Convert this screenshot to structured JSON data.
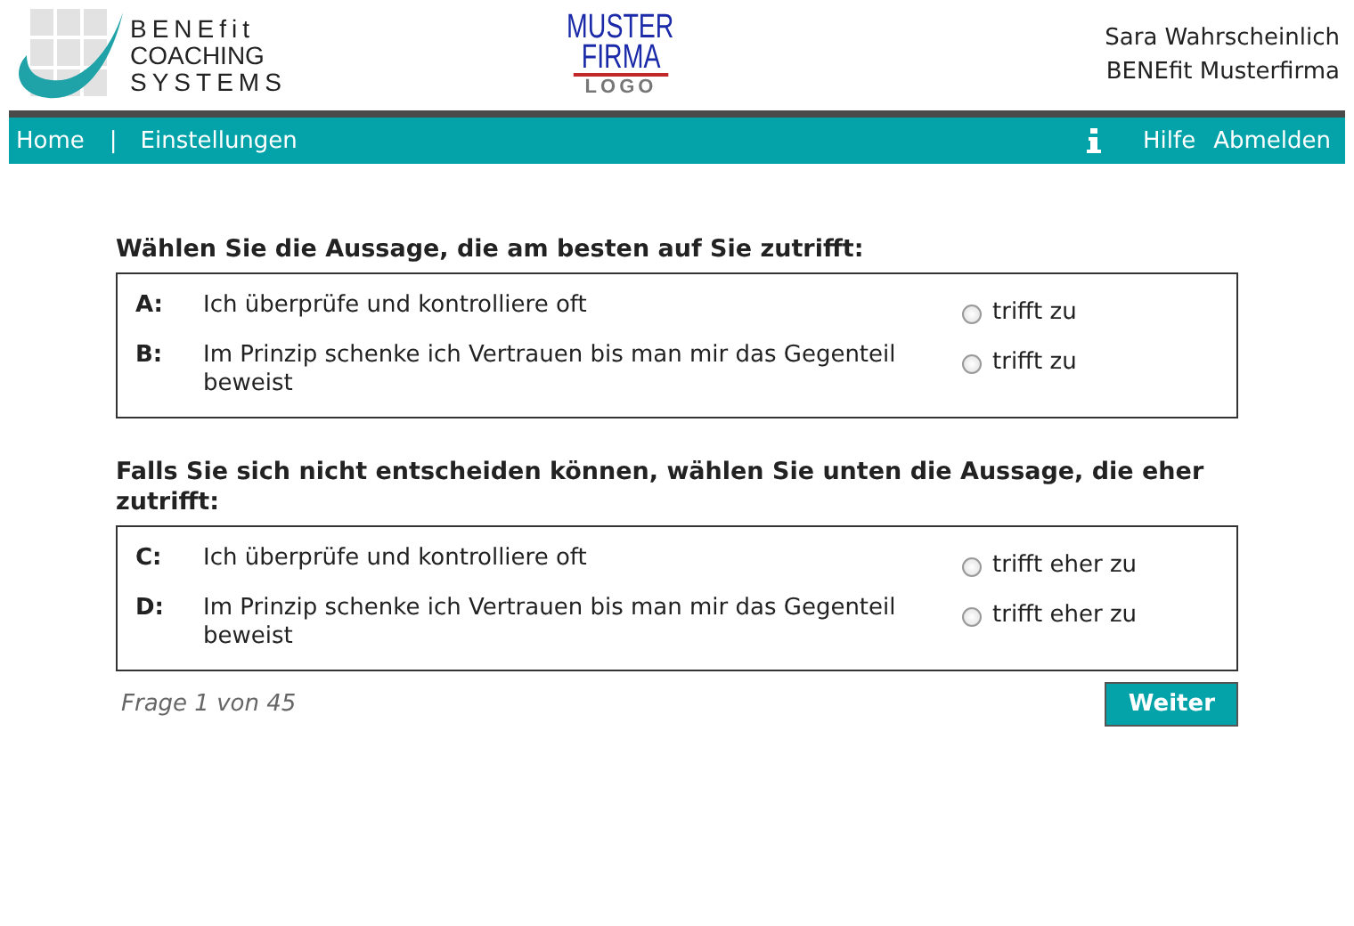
{
  "logo": {
    "lines": [
      "BENEfit",
      "COACHING",
      "SYSTEMS"
    ]
  },
  "company_logo": {
    "lines": [
      "MUSTER",
      "FIRMA",
      "LOGO"
    ]
  },
  "user": {
    "name": "Sara Wahrscheinlich",
    "company": "BENEfit Musterfirma"
  },
  "nav": {
    "left": [
      {
        "label": "Home"
      },
      {
        "label": "Einstellungen"
      }
    ],
    "separator": "|",
    "right": [
      {
        "label": "Hilfe"
      },
      {
        "label": "Abmelden"
      }
    ]
  },
  "sections": [
    {
      "heading": "Wählen Sie die Aussage, die am besten auf Sie zutrifft:",
      "options": [
        {
          "letter": "A:",
          "text": "Ich überprüfe und kontrolliere oft",
          "choice": "trifft zu",
          "selected": false
        },
        {
          "letter": "B:",
          "text": "Im Prinzip schenke ich Vertrauen bis man mir das Gegenteil beweist",
          "choice": "trifft zu",
          "selected": false
        }
      ]
    },
    {
      "heading": "Falls Sie sich nicht entscheiden können, wählen Sie unten die Aussage, die eher zutrifft:",
      "options": [
        {
          "letter": "C:",
          "text": "Ich überprüfe und kontrolliere oft",
          "choice": "trifft eher zu",
          "selected": false
        },
        {
          "letter": "D:",
          "text": "Im Prinzip schenke ich Vertrauen bis man mir das Gegenteil beweist",
          "choice": "trifft eher zu",
          "selected": false
        }
      ]
    }
  ],
  "progress": "Frage 1 von 45",
  "next_button": "Weiter"
}
